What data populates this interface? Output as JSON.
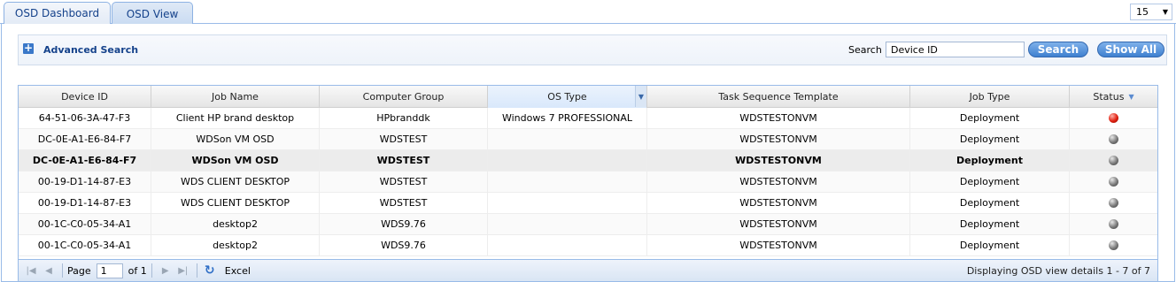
{
  "tabs": [
    {
      "label": "OSD Dashboard"
    },
    {
      "label": "OSD View"
    }
  ],
  "page_size": "15",
  "search_panel": {
    "advanced_label": "Advanced Search",
    "search_label": "Search",
    "search_value": "Device ID",
    "search_button": "Search",
    "show_all_button": "Show All"
  },
  "grid": {
    "columns": [
      "Device ID",
      "Job Name",
      "Computer Group",
      "OS Type",
      "Task Sequence Template",
      "Job Type",
      "Status"
    ],
    "rows": [
      {
        "device_id": "64-51-06-3A-47-F3",
        "job_name": "Client HP brand desktop",
        "group": "HPbranddk",
        "os": "Windows 7 PROFESSIONAL",
        "template": "WDSTESTONVM",
        "job_type": "Deployment",
        "status": "red"
      },
      {
        "device_id": "DC-0E-A1-E6-84-F7",
        "job_name": "WDSon VM OSD",
        "group": "WDSTEST",
        "os": "",
        "template": "WDSTESTONVM",
        "job_type": "Deployment",
        "status": "gray"
      },
      {
        "device_id": "DC-0E-A1-E6-84-F7",
        "job_name": "WDSon VM OSD",
        "group": "WDSTEST",
        "os": "",
        "template": "WDSTESTONVM",
        "job_type": "Deployment",
        "status": "gray"
      },
      {
        "device_id": "00-19-D1-14-87-E3",
        "job_name": "WDS CLIENT DESKTOP",
        "group": "WDSTEST",
        "os": "",
        "template": "WDSTESTONVM",
        "job_type": "Deployment",
        "status": "gray"
      },
      {
        "device_id": "00-19-D1-14-87-E3",
        "job_name": "WDS CLIENT DESKTOP",
        "group": "WDSTEST",
        "os": "",
        "template": "WDSTESTONVM",
        "job_type": "Deployment",
        "status": "gray"
      },
      {
        "device_id": "00-1C-C0-05-34-A1",
        "job_name": "desktop2",
        "group": "WDS9.76",
        "os": "",
        "template": "WDSTESTONVM",
        "job_type": "Deployment",
        "status": "gray"
      },
      {
        "device_id": "00-1C-C0-05-34-A1",
        "job_name": "desktop2",
        "group": "WDS9.76",
        "os": "",
        "template": "WDSTESTONVM",
        "job_type": "Deployment",
        "status": "gray"
      }
    ]
  },
  "pager": {
    "page_label": "Page",
    "page_value": "1",
    "of_label": "of 1",
    "excel_label": "Excel",
    "info": "Displaying OSD view details 1 - 7 of 7"
  },
  "colors": {
    "accent": "#3f80d0",
    "border": "#99bbe8",
    "status_red": "#e02010",
    "status_gray": "#7a7a7a"
  }
}
